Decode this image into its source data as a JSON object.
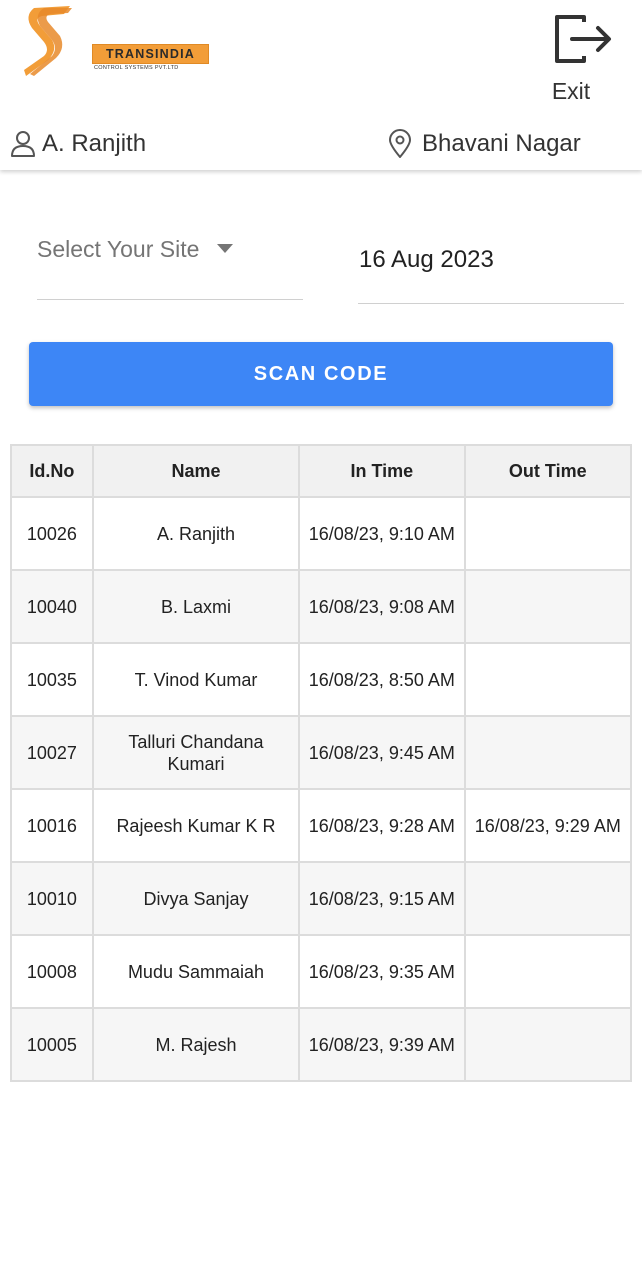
{
  "header": {
    "logo_name": "TRANSINDIA",
    "logo_subtitle": "CONTROL SYSTEMS PVT.LTD",
    "exit_label": "Exit",
    "user_name": "A. Ranjith",
    "location": "Bhavani Nagar"
  },
  "form": {
    "site_placeholder": "Select Your Site",
    "date_value": "16 Aug 2023",
    "scan_label": "SCAN CODE"
  },
  "table": {
    "headers": [
      "Id.No",
      "Name",
      "In Time",
      "Out Time"
    ],
    "rows": [
      {
        "id": "10026",
        "name": "A. Ranjith",
        "in": "16/08/23, 9:10 AM",
        "out": ""
      },
      {
        "id": "10040",
        "name": "B. Laxmi",
        "in": "16/08/23, 9:08 AM",
        "out": ""
      },
      {
        "id": "10035",
        "name": "T. Vinod Kumar",
        "in": "16/08/23, 8:50 AM",
        "out": ""
      },
      {
        "id": "10027",
        "name": "Talluri Chandana Kumari",
        "in": "16/08/23, 9:45 AM",
        "out": ""
      },
      {
        "id": "10016",
        "name": "Rajeesh Kumar K R",
        "in": "16/08/23, 9:28 AM",
        "out": "16/08/23, 9:29 AM"
      },
      {
        "id": "10010",
        "name": "Divya Sanjay",
        "in": "16/08/23, 9:15 AM",
        "out": ""
      },
      {
        "id": "10008",
        "name": "Mudu Sammaiah",
        "in": "16/08/23, 9:35 AM",
        "out": ""
      },
      {
        "id": "10005",
        "name": "M. Rajesh",
        "in": "16/08/23, 9:39 AM",
        "out": ""
      }
    ]
  },
  "colors": {
    "brand_orange": "#f29d38",
    "button_blue": "#3d86f6"
  },
  "icons": {
    "logo": "transindia-logo-icon",
    "exit": "exit-icon",
    "user": "user-icon",
    "location": "location-pin-icon",
    "dropdown": "caret-down-icon"
  }
}
